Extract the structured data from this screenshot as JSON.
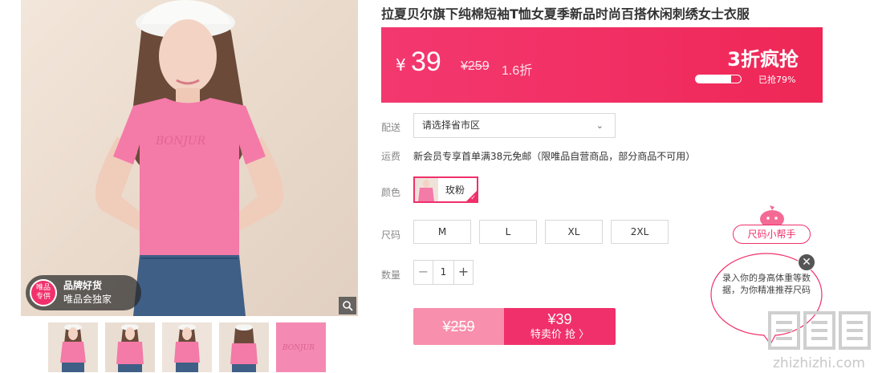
{
  "product": {
    "title": "拉夏贝尔旗下纯棉短袖T恤女夏季新品时尚百搭休闲刺绣女士衣服"
  },
  "gallery": {
    "shirt_text": "BONJUR",
    "badge": {
      "logo_line1": "唯品",
      "logo_line2": "专供",
      "line1": "品牌好货",
      "line2": "唯品会独家"
    },
    "thumbnail_count": 5,
    "thumb5_text": "BONJUR"
  },
  "price": {
    "currency": "¥",
    "current": "39",
    "original": "¥259",
    "discount": "1.6折",
    "promo_label": "3折疯抢",
    "sold_fraction": 0.79,
    "sold_text": "已抢79%"
  },
  "delivery": {
    "label": "配送",
    "placeholder": "请选择省市区",
    "arrow": "⌄"
  },
  "shipping": {
    "label": "运费",
    "text": "新会员专享首单满38元免邮（限唯品自营商品，部分商品不可用）"
  },
  "color": {
    "label": "颜色",
    "selected": "玫粉"
  },
  "size": {
    "label": "尺码",
    "options": [
      "M",
      "L",
      "XL",
      "2XL"
    ]
  },
  "quantity": {
    "label": "数量",
    "minus": "−",
    "value": "1",
    "plus": "+"
  },
  "buy": {
    "original": "¥259",
    "price": "¥39",
    "label": "特卖价 抢 〉"
  },
  "size_helper": {
    "title": "尺码小帮手",
    "text": "录入你的身高体重等数据，为你精准推荐尺码",
    "close": "✕"
  },
  "watermark": {
    "url": "zhizhizhi.com"
  },
  "colors": {
    "accent": "#f0306a",
    "price_bar": "#f12e62",
    "buy_left": "#f88fac"
  }
}
